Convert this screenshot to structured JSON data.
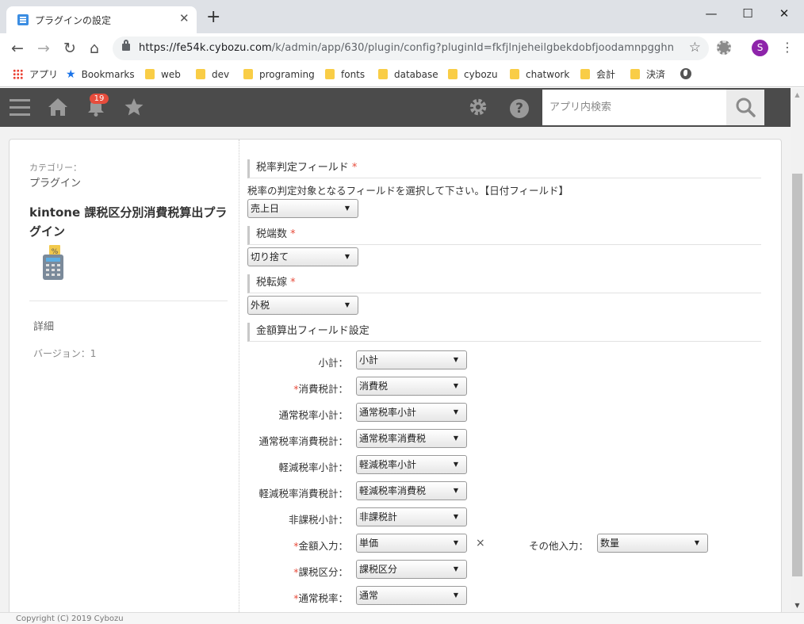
{
  "browser": {
    "tab_title": "プラグインの設定",
    "tab_close": "✕",
    "new_tab": "+",
    "win_minimize": "—",
    "win_maximize": "☐",
    "win_close": "✕",
    "url_host": "https://fe54k.cybozu.com",
    "url_path": "/k/admin/app/630/plugin/config?pluginId=fkfjlnjeheilgbekdobfjoodamnpgghn",
    "avatar_letter": "S",
    "bookmarks": [
      "アプリ",
      "Bookmarks",
      "web",
      "dev",
      "programing",
      "fonts",
      "database",
      "cybozu",
      "chatwork",
      "会計",
      "決済"
    ]
  },
  "header": {
    "notification_count": "19",
    "search_placeholder": "アプリ内検索",
    "help_label": "?"
  },
  "sidebar": {
    "category_label": "カテゴリー：",
    "category_value": "プラグイン",
    "plugin_name": "kintone 課税区分別消費税算出プラグイン",
    "detail_link": "詳細",
    "version": "バージョン：1"
  },
  "main": {
    "tax_rate_field": {
      "title": "税率判定フィールド",
      "required": "*",
      "description": "税率の判定対象となるフィールドを選択して下さい。【日付フィールド】",
      "selected": "売上日"
    },
    "rounding": {
      "title": "税端数",
      "required": "*",
      "selected": "切り捨て"
    },
    "tax_transfer": {
      "title": "税転嫁",
      "required": "*",
      "selected": "外税"
    },
    "amount_fields": {
      "title": "金額算出フィールド設定",
      "rows": [
        {
          "required": "",
          "label": "小計：",
          "selected": "小計"
        },
        {
          "required": "*",
          "label": "消費税計：",
          "selected": "消費税"
        },
        {
          "required": "",
          "label": "通常税率小計：",
          "selected": "通常税率小計"
        },
        {
          "required": "",
          "label": "通常税率消費税計：",
          "selected": "通常税率消費税"
        },
        {
          "required": "",
          "label": "軽減税率小計：",
          "selected": "軽減税率小計"
        },
        {
          "required": "",
          "label": "軽減税率消費税計：",
          "selected": "軽減税率消費税"
        },
        {
          "required": "",
          "label": "非課税小計：",
          "selected": "非課税計"
        },
        {
          "required": "*",
          "label": "金額入力：",
          "selected": "単価"
        },
        {
          "required": "*",
          "label": "課税区分：",
          "selected": "課税区分"
        },
        {
          "required": "*",
          "label": "通常税率：",
          "selected": "通常"
        }
      ],
      "multiply_sign": "×",
      "other_input_label": "その他入力：",
      "other_input_selected": "数量"
    }
  },
  "footer": {
    "copyright": "Copyright (C) 2019 Cybozu"
  }
}
